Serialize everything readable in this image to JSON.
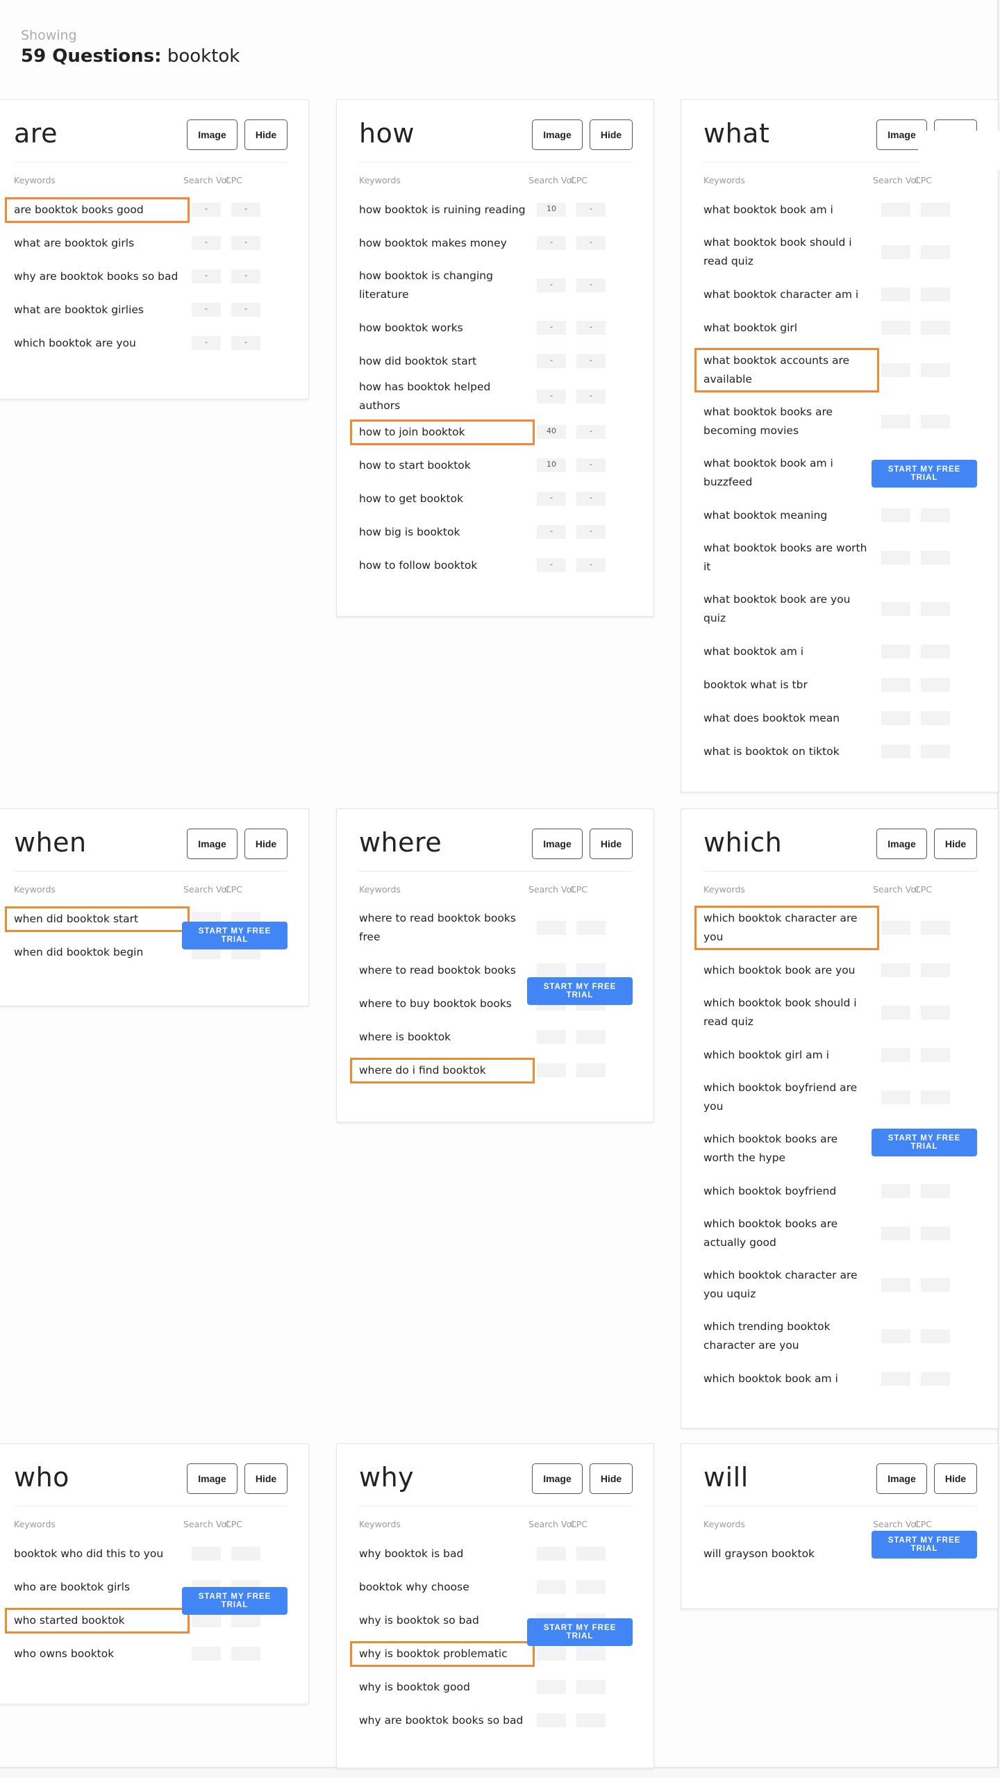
{
  "header": {
    "showing_label": "Showing",
    "count_label": "59 Questions:",
    "query": "booktok"
  },
  "common": {
    "image_button": "Image",
    "hide_button": "Hide",
    "col_keywords": "Keywords",
    "col_search_vol": "Search Vol.",
    "col_cpc": "CPC",
    "trial_button": "START MY FREE TRIAL"
  },
  "colors": {
    "highlight": "#f0892f",
    "trial_button": "#4285f4"
  },
  "cards": [
    {
      "title": "are",
      "rows": [
        {
          "keyword": "are booktok books good",
          "search_vol": "-",
          "cpc": "-",
          "highlighted": true
        },
        {
          "keyword": "what are booktok girls",
          "search_vol": "-",
          "cpc": "-"
        },
        {
          "keyword": "why are booktok books so bad",
          "search_vol": "-",
          "cpc": "-"
        },
        {
          "keyword": "what are booktok girlies",
          "search_vol": "-",
          "cpc": "-"
        },
        {
          "keyword": "which booktok are you",
          "search_vol": "-",
          "cpc": "-"
        }
      ]
    },
    {
      "title": "how",
      "rows": [
        {
          "keyword": "how booktok is ruining reading",
          "search_vol": "10",
          "cpc": "-"
        },
        {
          "keyword": "how booktok makes money",
          "search_vol": "-",
          "cpc": "-"
        },
        {
          "keyword": "how booktok is changing literature",
          "search_vol": "-",
          "cpc": "-"
        },
        {
          "keyword": "how booktok works",
          "search_vol": "-",
          "cpc": "-"
        },
        {
          "keyword": "how did booktok start",
          "search_vol": "-",
          "cpc": "-"
        },
        {
          "keyword": "how has booktok helped authors",
          "search_vol": "-",
          "cpc": "-"
        },
        {
          "keyword": "how to join booktok",
          "search_vol": "40",
          "cpc": "-",
          "highlighted": true
        },
        {
          "keyword": "how to start booktok",
          "search_vol": "10",
          "cpc": "-"
        },
        {
          "keyword": "how to get booktok",
          "search_vol": "-",
          "cpc": "-"
        },
        {
          "keyword": "how big is booktok",
          "search_vol": "-",
          "cpc": "-"
        },
        {
          "keyword": "how to follow booktok",
          "search_vol": "-",
          "cpc": "-"
        }
      ]
    },
    {
      "title": "what",
      "trial_after_row": 6,
      "rows": [
        {
          "keyword": "what booktok book am i",
          "search_vol": "",
          "cpc": ""
        },
        {
          "keyword": "what booktok book should i read quiz",
          "search_vol": "",
          "cpc": ""
        },
        {
          "keyword": "what booktok character am i",
          "search_vol": "",
          "cpc": ""
        },
        {
          "keyword": "what booktok girl",
          "search_vol": "",
          "cpc": ""
        },
        {
          "keyword": "what booktok accounts are available",
          "search_vol": "",
          "cpc": "",
          "highlighted": true
        },
        {
          "keyword": "what booktok books are becoming movies",
          "search_vol": "",
          "cpc": ""
        },
        {
          "keyword": "what booktok book am i buzzfeed",
          "search_vol": "",
          "cpc": ""
        },
        {
          "keyword": "what booktok meaning",
          "search_vol": "",
          "cpc": ""
        },
        {
          "keyword": "what booktok books are worth it",
          "search_vol": "",
          "cpc": ""
        },
        {
          "keyword": "what booktok book are you quiz",
          "search_vol": "",
          "cpc": ""
        },
        {
          "keyword": "what booktok am i",
          "search_vol": "",
          "cpc": ""
        },
        {
          "keyword": "booktok what is tbr",
          "search_vol": "",
          "cpc": ""
        },
        {
          "keyword": "what does booktok mean",
          "search_vol": "",
          "cpc": ""
        },
        {
          "keyword": "what is booktok on tiktok",
          "search_vol": "",
          "cpc": ""
        }
      ]
    },
    {
      "title": "when",
      "rows": [
        {
          "keyword": "when did booktok start",
          "search_vol": "",
          "cpc": "",
          "highlighted": true
        },
        {
          "keyword": "when did booktok begin",
          "search_vol": "",
          "cpc": ""
        }
      ]
    },
    {
      "title": "where",
      "rows": [
        {
          "keyword": "where to read booktok books free",
          "search_vol": "",
          "cpc": ""
        },
        {
          "keyword": "where to read booktok books",
          "search_vol": "",
          "cpc": ""
        },
        {
          "keyword": "where to buy booktok books",
          "search_vol": "",
          "cpc": ""
        },
        {
          "keyword": "where is booktok",
          "search_vol": "",
          "cpc": ""
        },
        {
          "keyword": "where do i find booktok",
          "search_vol": "",
          "cpc": "",
          "highlighted": true
        }
      ]
    },
    {
      "title": "which",
      "rows": [
        {
          "keyword": "which booktok character are you",
          "search_vol": "",
          "cpc": "",
          "highlighted": true
        },
        {
          "keyword": "which booktok book are you",
          "search_vol": "",
          "cpc": ""
        },
        {
          "keyword": "which booktok book should i read quiz",
          "search_vol": "",
          "cpc": ""
        },
        {
          "keyword": "which booktok girl am i",
          "search_vol": "",
          "cpc": ""
        },
        {
          "keyword": "which booktok boyfriend are you",
          "search_vol": "",
          "cpc": ""
        },
        {
          "keyword": "which booktok books are worth the hype",
          "search_vol": "",
          "cpc": ""
        },
        {
          "keyword": "which booktok boyfriend",
          "search_vol": "",
          "cpc": ""
        },
        {
          "keyword": "which booktok books are actually good",
          "search_vol": "",
          "cpc": ""
        },
        {
          "keyword": "which booktok character are you uquiz",
          "search_vol": "",
          "cpc": ""
        },
        {
          "keyword": "which trending booktok character are you",
          "search_vol": "",
          "cpc": ""
        },
        {
          "keyword": "which booktok book am i",
          "search_vol": "",
          "cpc": ""
        }
      ]
    },
    {
      "title": "who",
      "rows": [
        {
          "keyword": "booktok who did this to you",
          "search_vol": "",
          "cpc": ""
        },
        {
          "keyword": "who are booktok girls",
          "search_vol": "",
          "cpc": ""
        },
        {
          "keyword": "who started booktok",
          "search_vol": "",
          "cpc": "",
          "highlighted": true
        },
        {
          "keyword": "who owns booktok",
          "search_vol": "",
          "cpc": ""
        }
      ]
    },
    {
      "title": "why",
      "rows": [
        {
          "keyword": "why booktok is bad",
          "search_vol": "",
          "cpc": ""
        },
        {
          "keyword": "booktok why choose",
          "search_vol": "",
          "cpc": ""
        },
        {
          "keyword": "why is booktok so bad",
          "search_vol": "",
          "cpc": ""
        },
        {
          "keyword": "why is booktok problematic",
          "search_vol": "",
          "cpc": "",
          "highlighted": true
        },
        {
          "keyword": "why is booktok good",
          "search_vol": "",
          "cpc": ""
        },
        {
          "keyword": "why are booktok books so bad",
          "search_vol": "",
          "cpc": ""
        }
      ]
    },
    {
      "title": "will",
      "rows": [
        {
          "keyword": "will grayson booktok",
          "search_vol": "",
          "cpc": ""
        }
      ]
    }
  ]
}
